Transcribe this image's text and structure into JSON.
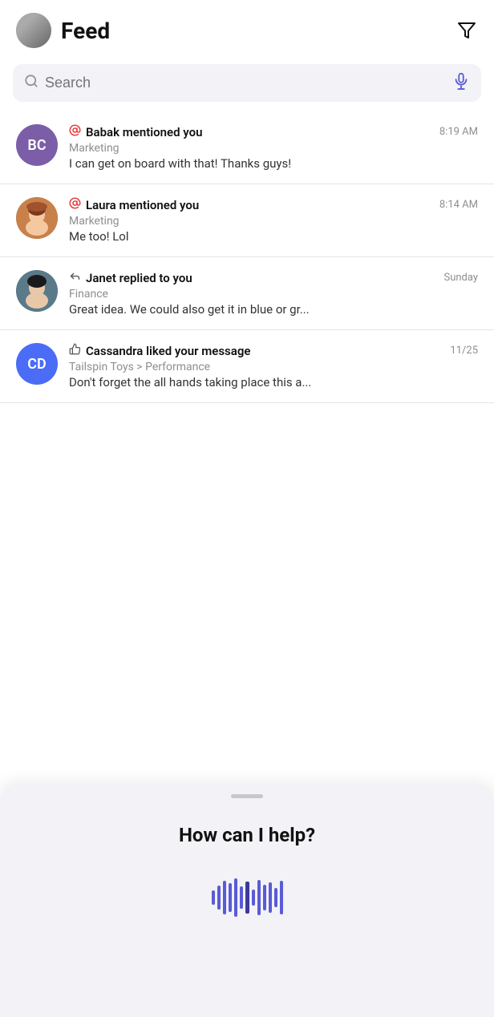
{
  "header": {
    "title": "Feed",
    "filter_label": "filter"
  },
  "search": {
    "placeholder": "Search"
  },
  "feed": {
    "items": [
      {
        "id": "babak",
        "avatar_type": "initials",
        "avatar_initials": "BC",
        "avatar_color": "purple",
        "action_icon": "mention",
        "action_label": "Babak mentioned you",
        "timestamp": "8:19 AM",
        "channel": "Marketing",
        "message": "I can get on board with that! Thanks guys!"
      },
      {
        "id": "laura",
        "avatar_type": "photo",
        "avatar_color": "laura",
        "action_icon": "mention",
        "action_label": "Laura mentioned you",
        "timestamp": "8:14 AM",
        "channel": "Marketing",
        "message": "Me too! Lol"
      },
      {
        "id": "janet",
        "avatar_type": "photo",
        "avatar_color": "janet",
        "action_icon": "reply",
        "action_label": "Janet replied to you",
        "timestamp": "Sunday",
        "channel": "Finance",
        "message": "Great idea. We could also get it in blue or gr..."
      },
      {
        "id": "cassandra",
        "avatar_type": "initials",
        "avatar_initials": "CD",
        "avatar_color": "blue",
        "action_icon": "like",
        "action_label": "Cassandra liked your message",
        "timestamp": "11/25",
        "channel": "Tailspin Toys > Performance",
        "message": "Don't forget the all hands taking place this a..."
      }
    ]
  },
  "assistant": {
    "title": "How can I help?",
    "drag_hint": "drag"
  },
  "waveform": {
    "bars": [
      18,
      30,
      42,
      36,
      48,
      28,
      40,
      20,
      44,
      32,
      38,
      24,
      42
    ]
  }
}
